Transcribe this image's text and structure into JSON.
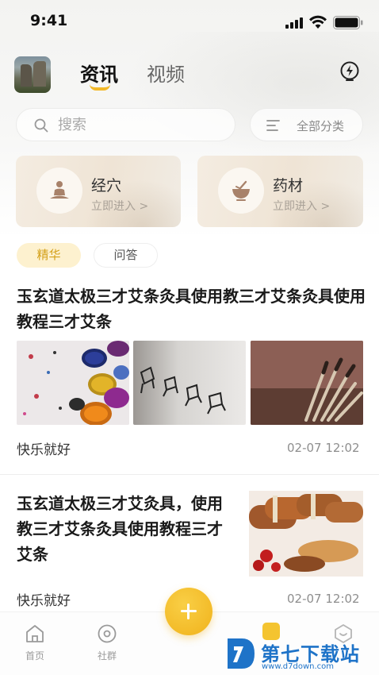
{
  "status_bar": {
    "time": "9:41"
  },
  "header": {
    "tabs": [
      {
        "label": "资讯",
        "active": true
      },
      {
        "label": "视频",
        "active": false
      }
    ]
  },
  "search": {
    "placeholder": "搜索"
  },
  "category_filter": {
    "label": "全部分类"
  },
  "feature_cards": [
    {
      "title": "经穴",
      "subtitle": "立即进入 >",
      "icon": "meditation-icon"
    },
    {
      "title": "药材",
      "subtitle": "立即进入 >",
      "icon": "herb-bowl-icon"
    }
  ],
  "filters": [
    {
      "label": "精华",
      "active": true
    },
    {
      "label": "问答",
      "active": false
    }
  ],
  "articles": [
    {
      "title": "玉玄道太极三才艾条灸具使用教三才艾条灸具使用教程三才艾条",
      "author": "快乐就好",
      "time": "02-07 12:02",
      "images": [
        "paint-cans-image",
        "chairs-image",
        "brushes-image"
      ]
    },
    {
      "title": "玉玄道太极三才艾灸具，使用教三才艾条灸具使用教程三才艾条",
      "author": "快乐就好",
      "time": "02-07 12:02",
      "images": [
        "cinnamon-herbs-image"
      ]
    }
  ],
  "tab_bar": {
    "items": [
      {
        "label": "首页",
        "icon": "home-icon"
      },
      {
        "label": "社群",
        "icon": "community-icon"
      },
      {
        "label": "",
        "icon": "mine-icon"
      }
    ],
    "fab_icon": "plus-icon"
  },
  "watermark": {
    "name": "第七下载站",
    "url": "www.d7down.com"
  },
  "colors": {
    "accent": "#f0b21b",
    "watermark": "#1e73c8",
    "pill_active_bg": "#fdf1cf"
  }
}
